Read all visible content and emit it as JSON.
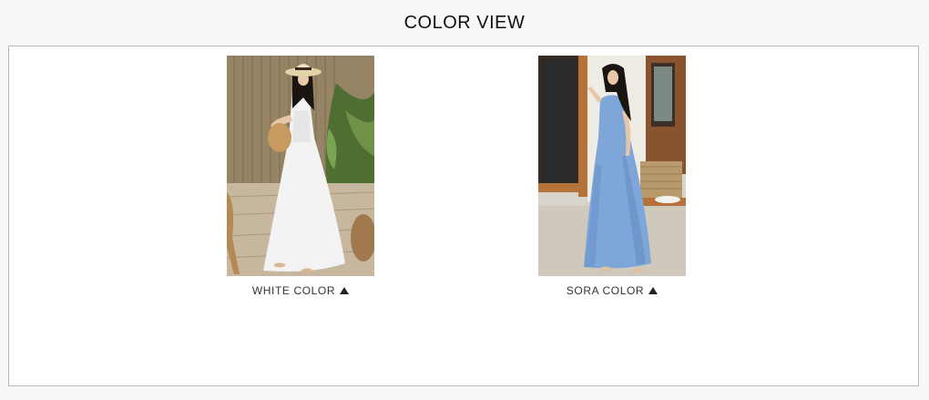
{
  "header": {
    "title": "COLOR VIEW"
  },
  "colors": [
    {
      "label": "WHITE COLOR",
      "image_icon": "model-white-dress-photo",
      "arrow_icon": "up-triangle-icon",
      "accent": "#ffffff"
    },
    {
      "label": "SORA COLOR",
      "image_icon": "model-sora-blue-dress-photo",
      "arrow_icon": "up-triangle-icon",
      "accent": "#7da3d6"
    }
  ]
}
